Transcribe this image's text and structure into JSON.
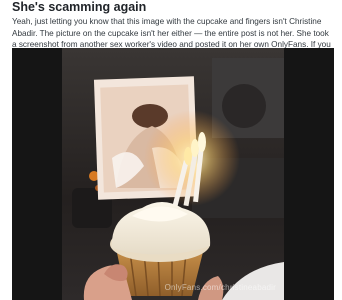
{
  "post": {
    "title": "She's scamming again",
    "body": "Yeah, just letting you know that this image with the cupcake and fingers isn't Christine Abadir. The picture on the cupcake isn't her either — the entire post is not her. She took a screenshot from another sex worker's video and posted it on her own OnlyFans. If you paid for this, contact your bank and report the post.",
    "image": {
      "watermark": "OnlyFans.com/christineabadir",
      "icons": [
        "cupcake-photo",
        "birthday-candles",
        "hand-holding-cupcake"
      ]
    }
  }
}
